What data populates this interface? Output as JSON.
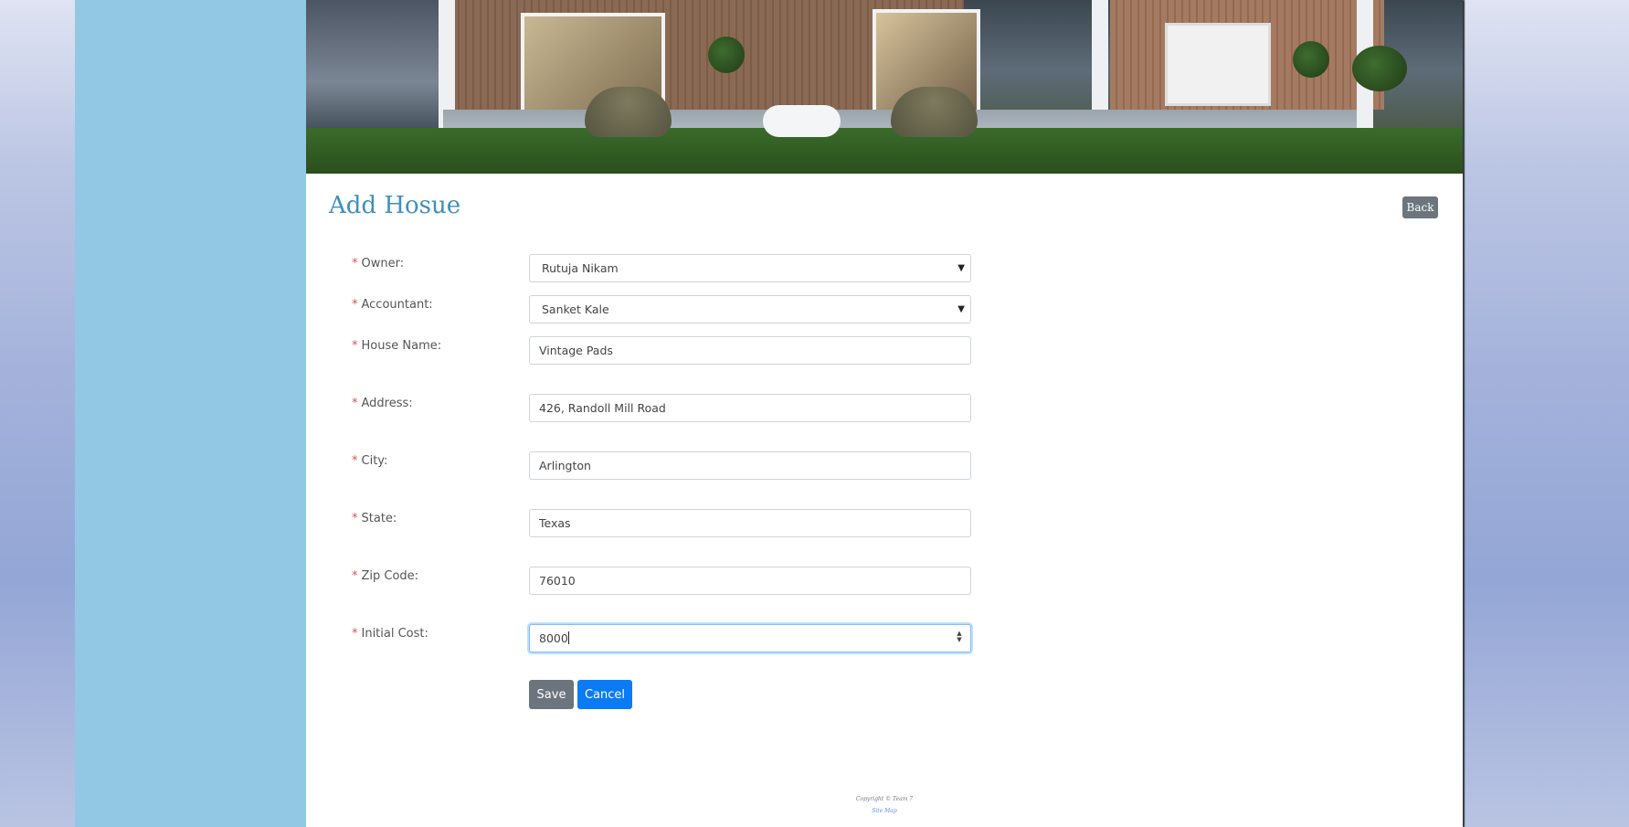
{
  "page": {
    "title": "Add Hosue",
    "back_label": "Back"
  },
  "form": {
    "fields": [
      {
        "label": "Owner:",
        "value": "Rutuja Nikam",
        "type": "select"
      },
      {
        "label": "Accountant:",
        "value": "Sanket Kale",
        "type": "select"
      },
      {
        "label": "House Name:",
        "value": "Vintage Pads",
        "type": "text"
      },
      {
        "label": "Address:",
        "value": "426, Randoll Mill Road",
        "type": "text"
      },
      {
        "label": "City:",
        "value": "Arlington",
        "type": "text"
      },
      {
        "label": "State:",
        "value": "Texas",
        "type": "text"
      },
      {
        "label": "Zip Code:",
        "value": "76010",
        "type": "text"
      },
      {
        "label": "Initial Cost:",
        "value": "8000",
        "type": "number"
      }
    ],
    "required_marker": "*",
    "save_label": "Save",
    "cancel_label": "Cancel"
  },
  "footer": {
    "copyright": "Copyright © Team 7",
    "sitemap": "Site Map"
  },
  "colors": {
    "accent": "#3f8fbd",
    "sidebar": "#93c8e4",
    "primary_button": "#0a7bf5",
    "secondary_button": "#6c757d"
  }
}
